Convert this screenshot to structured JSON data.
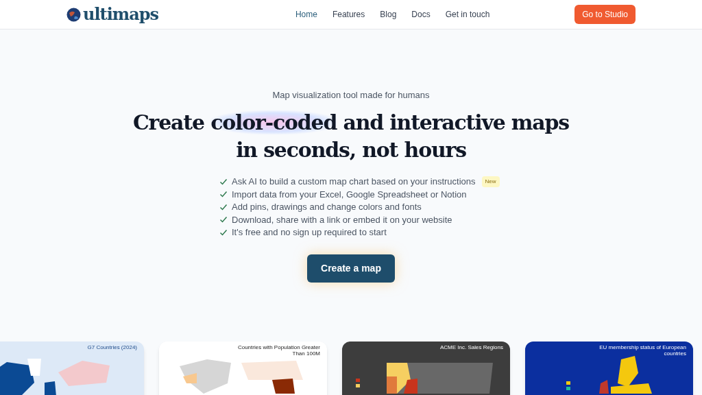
{
  "header": {
    "logo": "ultimaps",
    "nav": [
      {
        "label": "Home",
        "selected": true
      },
      {
        "label": "Features",
        "selected": false
      },
      {
        "label": "Blog",
        "selected": false
      },
      {
        "label": "Docs",
        "selected": false
      },
      {
        "label": "Get in touch",
        "selected": false
      }
    ],
    "cta": "Go to Studio"
  },
  "hero": {
    "tagline": "Map visualization tool made for humans",
    "headline_highlight": "color-coded",
    "headline_before": "Create",
    "headline_after": "and interactive maps in seconds, not hours",
    "features": [
      {
        "text": "Ask AI to build a custom map chart based on your instructions",
        "badge": "New"
      },
      {
        "text": "Import data from your Excel, Google Spreadsheet or Notion"
      },
      {
        "text": "Add pins, drawings and change colors and fonts"
      },
      {
        "text": "Download, share with a link or embed it on your website"
      },
      {
        "text": "It's free and no sign up required to start"
      }
    ],
    "button": "Create a map"
  },
  "examples": [
    {
      "kind": "world-blue",
      "title": "G7 Countries (2024)"
    },
    {
      "kind": "world-orange",
      "title": "Countries with Population Greater Than 100M"
    },
    {
      "kind": "usa",
      "title": "ACME Inc. Sales Regions"
    },
    {
      "kind": "europe",
      "title": "EU membership status of European countries"
    }
  ]
}
